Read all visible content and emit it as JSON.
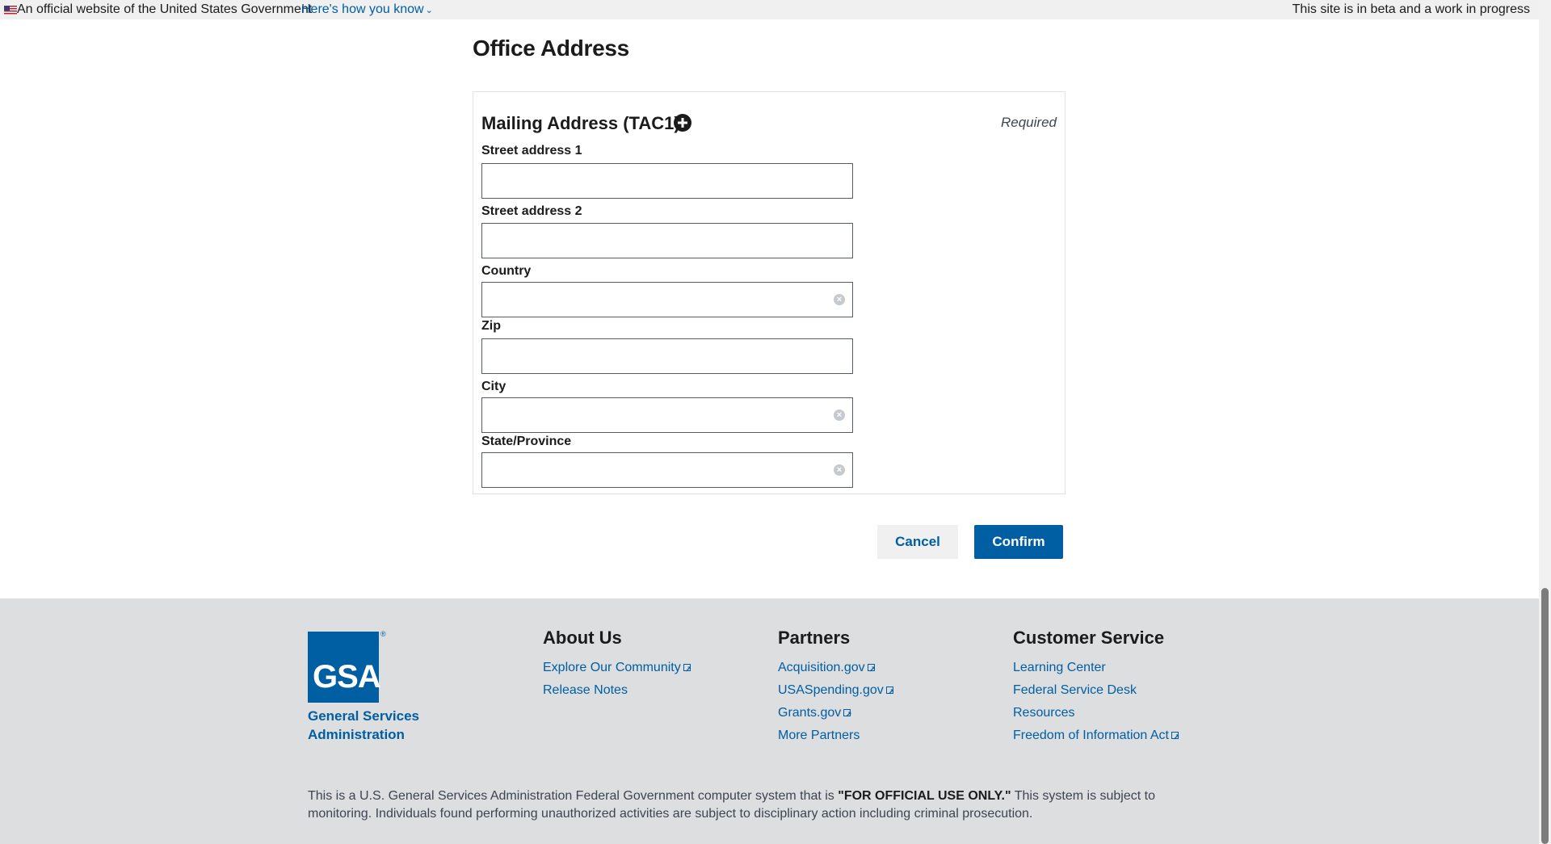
{
  "banner": {
    "official": "An official website of the United States Government",
    "how_you_know": "Here's how you know",
    "beta": "This site is in beta and a work in progress"
  },
  "page": {
    "title": "Office Address"
  },
  "card": {
    "title": "Mailing Address (TAC1)",
    "required": "Required",
    "fields": {
      "street1": {
        "label": "Street address 1",
        "value": ""
      },
      "street2": {
        "label": "Street address 2",
        "value": ""
      },
      "country": {
        "label": "Country",
        "value": ""
      },
      "zip": {
        "label": "Zip",
        "value": ""
      },
      "city": {
        "label": "City",
        "value": ""
      },
      "state": {
        "label": "State/Province",
        "value": ""
      }
    }
  },
  "actions": {
    "cancel": "Cancel",
    "confirm": "Confirm"
  },
  "footer": {
    "logo_text": "GSA",
    "org_name": "General Services Administration",
    "about": {
      "heading": "About Us",
      "links": [
        "Explore Our Community",
        "Release Notes"
      ]
    },
    "partners": {
      "heading": "Partners",
      "links": [
        "Acquisition.gov",
        "USASpending.gov",
        "Grants.gov",
        "More Partners"
      ]
    },
    "customer": {
      "heading": "Customer Service",
      "links": [
        "Learning Center",
        "Federal Service Desk",
        "Resources",
        "Freedom of Information Act"
      ]
    },
    "disclaimer_pre": "This is a U.S. General Services Administration Federal Government computer system that is ",
    "disclaimer_bold": "\"FOR OFFICIAL USE ONLY.\"",
    "disclaimer_post": " This system is subject to monitoring. Individuals found performing unauthorized activities are subject to disciplinary action including criminal prosecution."
  },
  "colors": {
    "primary": "#005ea2",
    "footer_bg": "#dcdee0",
    "banner_bg": "#f0f0f0"
  }
}
